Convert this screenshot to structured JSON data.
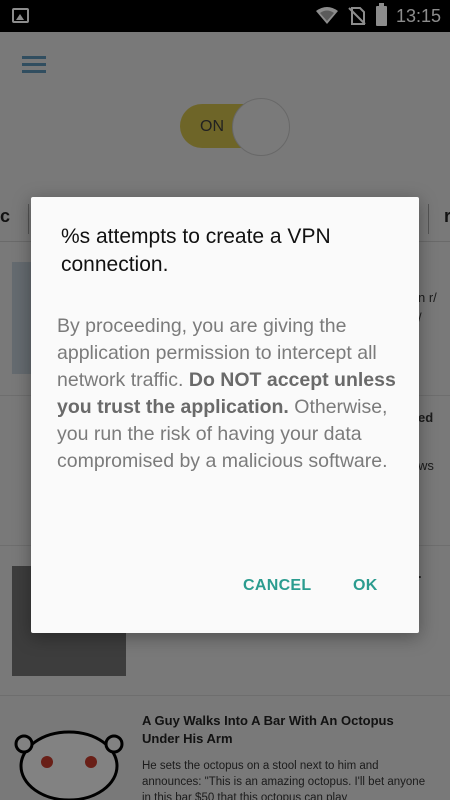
{
  "statusbar": {
    "time": "13:15",
    "icons": [
      "image-icon",
      "wifi-icon",
      "no-sim-icon",
      "battery-icon"
    ]
  },
  "app": {
    "toggle_label": "ON",
    "tab_left_fragment": "c",
    "tab_right_fragment": "r",
    "peek_texts": [
      "n r/",
      "/",
      "ed",
      "ws",
      "."
    ],
    "story": {
      "title": "A Guy Walks Into A Bar With An Octopus Under His Arm",
      "body": "He sets the octopus on a stool next to him and announces: \"This is an amazing octopus. I'll bet anyone in this bar $50 that this octopus can play"
    }
  },
  "dialog": {
    "title": "%s attempts to create a VPN connection.",
    "message_part1": "By proceeding, you are giving the application permission to intercept all network traffic. ",
    "message_bold": "Do NOT accept unless you trust the application.",
    "message_part2": " Otherwise, you run the risk of having your data compromised by a malicious software.",
    "cancel_label": "CANCEL",
    "ok_label": "OK"
  },
  "colors": {
    "accent": "#2b9c8f",
    "toggle_on": "#e8d84a",
    "status_bar": "#000000"
  }
}
